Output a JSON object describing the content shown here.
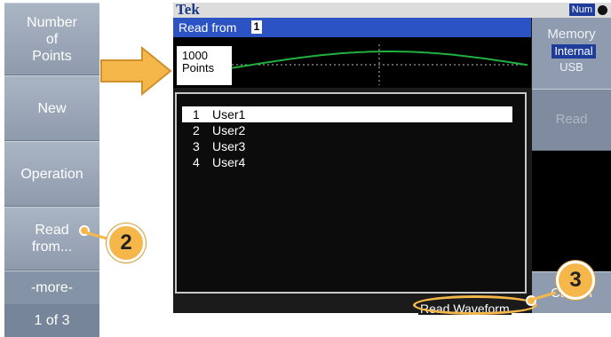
{
  "left_softkeys": [
    {
      "label": "Number\nof\nPoints"
    },
    {
      "label": "New"
    },
    {
      "label": "Operation"
    },
    {
      "label": "Read\nfrom..."
    },
    {
      "label": "-more-"
    },
    {
      "label": "1 of 3"
    }
  ],
  "topbar": {
    "brand": "Tek",
    "num_badge": "Num"
  },
  "title": {
    "text": "Read from",
    "slot": "1"
  },
  "preview": {
    "points_value": "1000",
    "points_unit": "Points"
  },
  "list": [
    {
      "index": "1",
      "name": "User1",
      "selected": true
    },
    {
      "index": "2",
      "name": "User2",
      "selected": false
    },
    {
      "index": "3",
      "name": "User3",
      "selected": false
    },
    {
      "index": "4",
      "name": "User4",
      "selected": false
    }
  ],
  "right_menu": {
    "memory_title": "Memory",
    "memory_internal": "Internal",
    "memory_usb": "USB",
    "read": "Read",
    "cancel": "Cancel"
  },
  "bottom_label": "Read Waveform",
  "callouts": {
    "step2": "2",
    "step3": "3"
  },
  "colors": {
    "accent": "#2b53c4",
    "callout": "#f6b74a",
    "softkey": "#8f9caf",
    "waveform": "#20b040"
  }
}
